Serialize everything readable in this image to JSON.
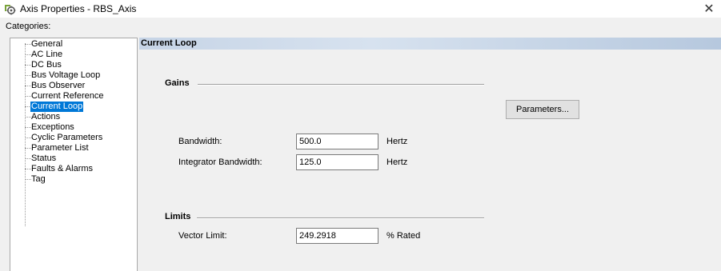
{
  "window": {
    "title": "Axis Properties - RBS_Axis",
    "app_icon": "axis-gear-icon",
    "close_glyph": "✕"
  },
  "categories": {
    "label": "Categories:",
    "items": [
      {
        "label": "General",
        "selected": false
      },
      {
        "label": "AC Line",
        "selected": false
      },
      {
        "label": "DC Bus",
        "selected": false
      },
      {
        "label": "Bus Voltage Loop",
        "selected": false
      },
      {
        "label": "Bus Observer",
        "selected": false
      },
      {
        "label": "Current Reference",
        "selected": false
      },
      {
        "label": "Current Loop",
        "selected": true
      },
      {
        "label": "Actions",
        "selected": false
      },
      {
        "label": "Exceptions",
        "selected": false
      },
      {
        "label": "Cyclic Parameters",
        "selected": false
      },
      {
        "label": "Parameter List",
        "selected": false
      },
      {
        "label": "Status",
        "selected": false
      },
      {
        "label": "Faults & Alarms",
        "selected": false
      },
      {
        "label": "Tag",
        "selected": false
      }
    ],
    "selected_color": "#0078d7"
  },
  "page": {
    "title": "Current Loop",
    "gains": {
      "label": "Gains",
      "parameters_button": "Parameters...",
      "bandwidth": {
        "label": "Bandwidth:",
        "value": "500.0",
        "unit": "Hertz"
      },
      "integrator_bandwidth": {
        "label": "Integrator Bandwidth:",
        "value": "125.0",
        "unit": "Hertz"
      }
    },
    "limits": {
      "label": "Limits",
      "vector_limit": {
        "label": "Vector Limit:",
        "value": "249.2918",
        "unit": "% Rated"
      }
    }
  }
}
